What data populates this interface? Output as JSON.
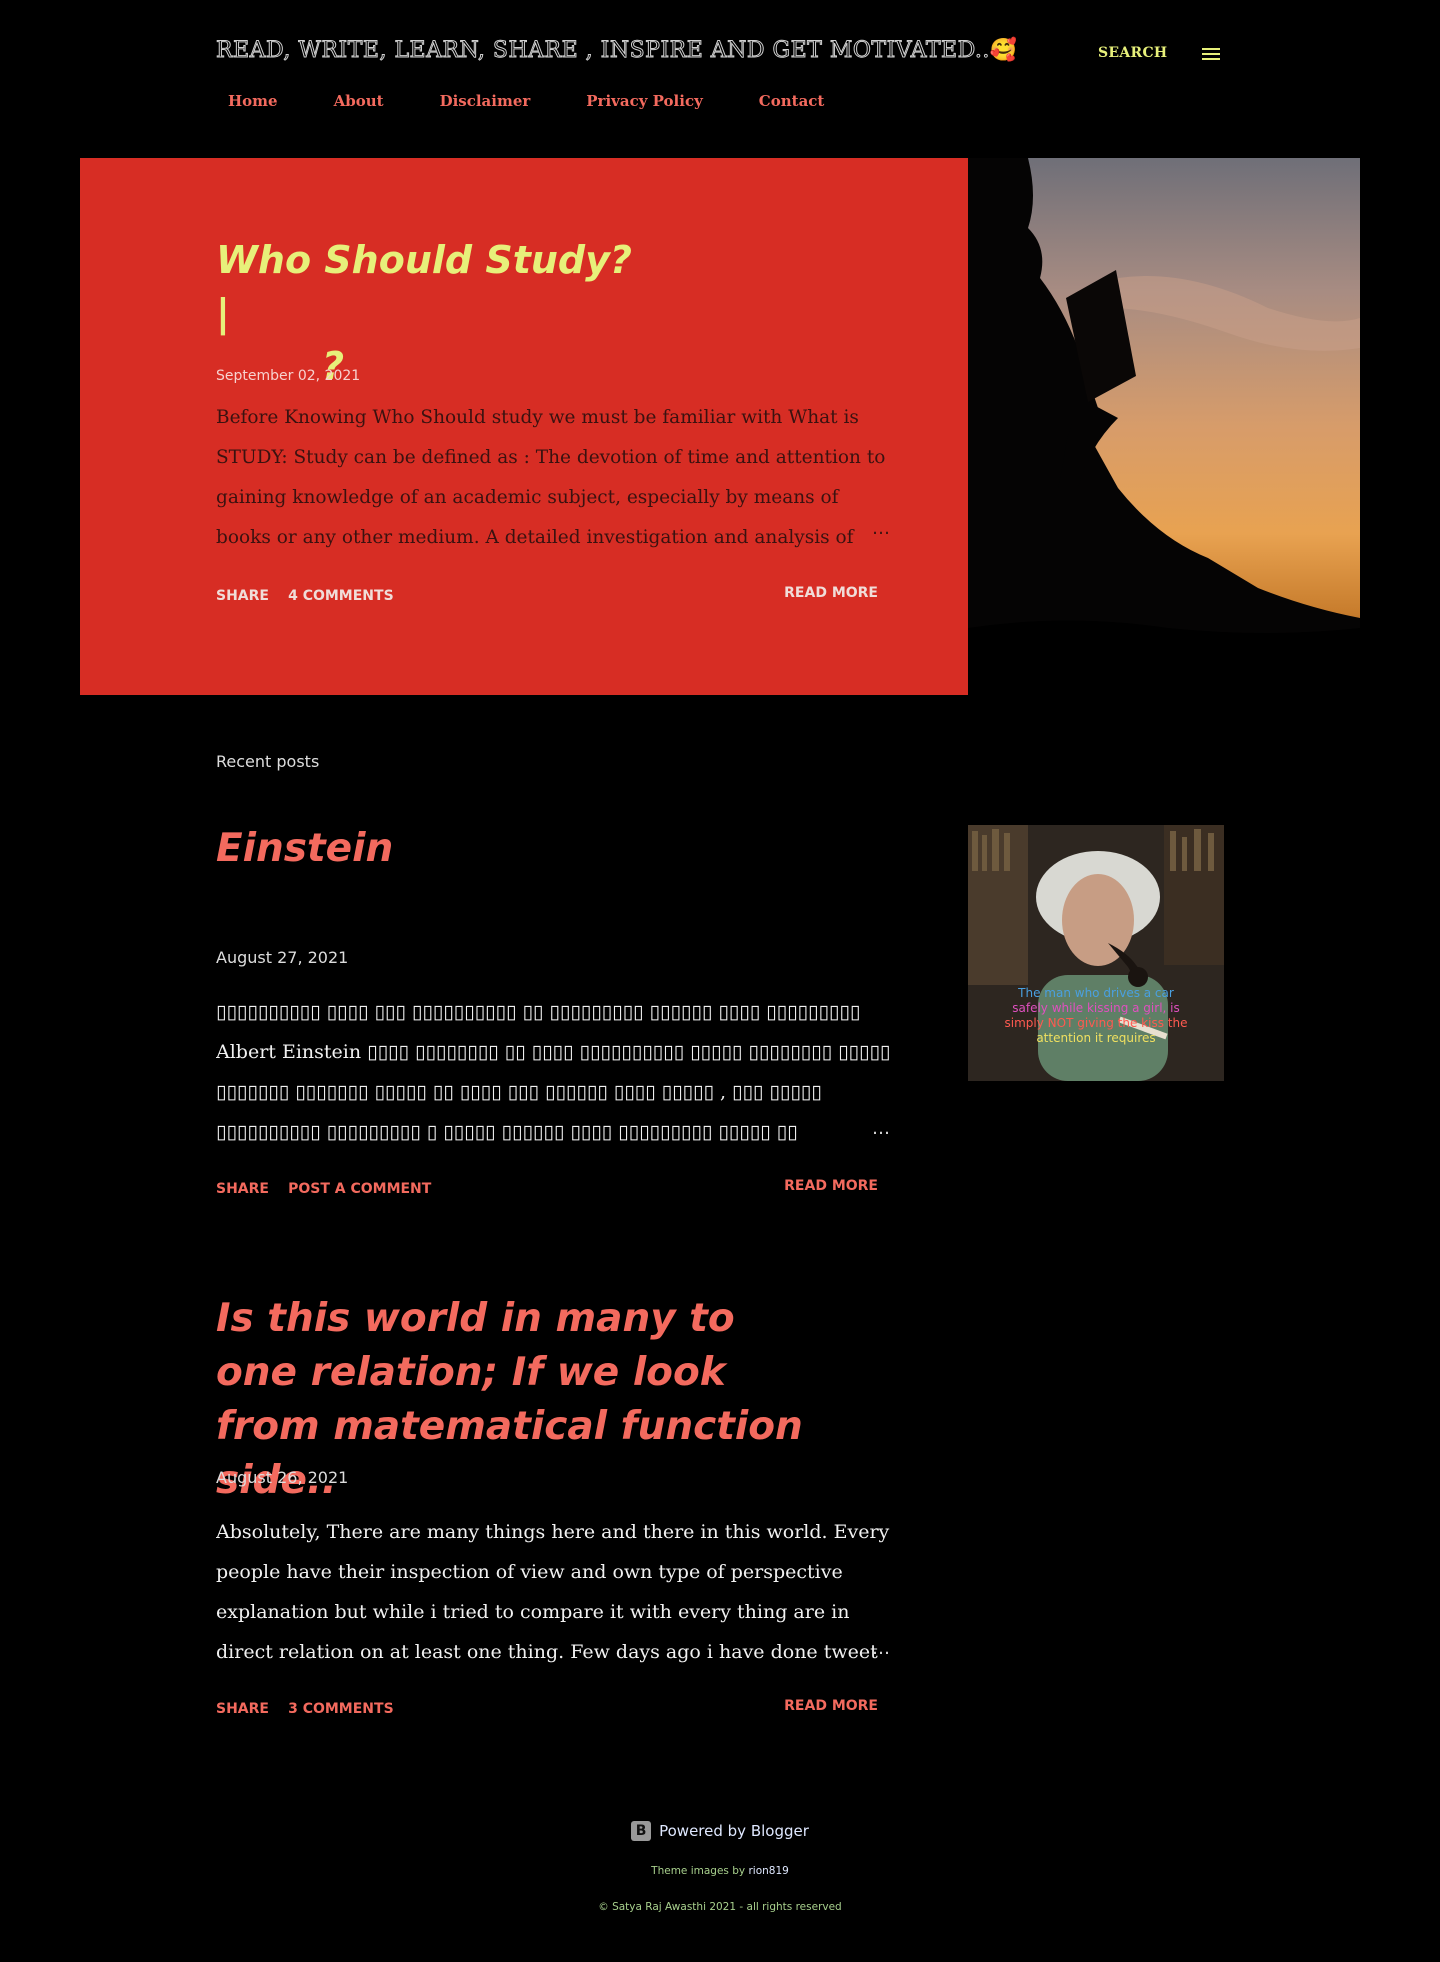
{
  "header": {
    "site_title": "READ, WRITE, LEARN, SHARE , INSPIRE AND GET MOTIVATED..",
    "site_title_emoji": "🥰",
    "search_label": "SEARCH",
    "menu_icon": "hamburger-menu-icon",
    "nav": [
      "Home",
      "About",
      "Disclaimer",
      "Privacy Policy",
      "Contact"
    ]
  },
  "hero": {
    "title_line1": "Who Should Study? |",
    "title_line2": "?",
    "date": "September 02, 2021",
    "snippet": " Before Knowing Who Should study we must be familiar with What is STUDY: Study can be defined as :    The devotion of time and attention to gaining knowledge of an academic subject, especially by means of books or any other medium. A detailed investigation and analysis of",
    "ellipsis": "…",
    "share_label": "Share",
    "comments_label": "4 Comments",
    "read_more_label": "Read more",
    "image": "silhouette-reading-at-sunset"
  },
  "recent_posts_label": "Recent posts",
  "posts": [
    {
      "title": "Einstein",
      "date": "August 27, 2021",
      "snippet": "     ▯▯▯▯▯▯▯▯▯▯ ▯▯▯▯ ▯▯▯ ▯▯▯▯▯▯▯▯▯▯ ▯▯ ▯▯▯▯▯▯▯▯▯ ▯▯▯▯▯▯ ▯▯▯▯ ▯▯▯▯▯▯▯▯▯ Albert Einstein ▯▯▯▯ ▯▯▯▯▯▯▯▯ ▯▯ ▯▯▯▯ ▯▯▯▯▯▯▯▯▯▯ ▯▯▯▯▯ ▯▯▯▯▯▯▯▯ ▯▯▯▯▯ ▯▯▯▯▯▯▯ ▯▯▯▯▯▯▯ ▯▯▯▯▯ ▯▯ ▯▯▯▯ ▯▯▯ ▯▯▯▯▯▯ ▯▯▯▯   ▯▯▯▯▯ , ▯▯▯ ▯▯▯▯▯ ▯▯▯▯▯▯▯▯▯▯ ▯▯▯▯▯▯▯▯▯ ▯ ▯▯▯▯▯ ▯▯▯▯▯▯ ▯▯▯▯ ▯▯▯▯▯▯▯▯▯ ▯▯▯▯▯ ▯▯",
      "ellipsis": "…",
      "share_label": "Share",
      "comments_label": "Post a Comment",
      "read_more_label": "Read more",
      "thumbnail": "einstein-with-pipe-photo",
      "thumbnail_caption": "The man who drives a car safely while kissing a girl, is simply NOT giving the kiss the attention it requires"
    },
    {
      "title": "Is this world in many to one relation; If we look from matematical function side..",
      "date": "August 26, 2021",
      "snippet": " Absolutely, There are many things here and there in this world. Every people have their inspection of view and own type of perspective explanation but while i tried to compare it with every thing are in direct relation on at least one thing.   Few days ago i have done tweet",
      "ellipsis": "…",
      "share_label": "Share",
      "comments_label": "3 Comments",
      "read_more_label": "Read more"
    }
  ],
  "footer": {
    "powered_by": "Powered by Blogger",
    "blogger_icon": "blogger-b-icon",
    "theme_images_prefix": "Theme images by ",
    "theme_images_author": "rion819",
    "copyright": "© Satya Raj Awasthi 2021 - all rights reserved"
  },
  "colors": {
    "background": "#000000",
    "accent": "#f36a5e",
    "hero_bg": "#d72d24",
    "hero_title": "#e7f07a",
    "search": "#e7f07a"
  }
}
